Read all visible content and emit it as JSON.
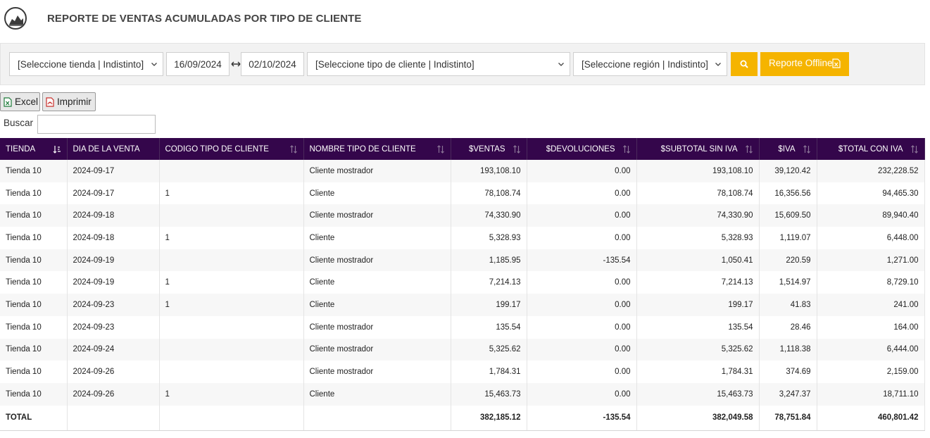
{
  "header": {
    "title": "REPORTE DE VENTAS ACUMULADAS POR TIPO DE CLIENTE",
    "logo_icon": "area-chart-icon"
  },
  "filters": {
    "store": "[Seleccione tienda | Indistinto]",
    "date_from": "16/09/2024",
    "date_to": "02/10/2024",
    "client_type": "[Seleccione tipo de cliente | Indistinto]",
    "region": "[Seleccione región | Indistinto]",
    "offline_label": "Reporte Offline"
  },
  "colors": {
    "accent": "#f5b400",
    "table_header": "#34064b"
  },
  "toolbar": {
    "excel_label": "Excel",
    "print_label": "Imprimir",
    "search_label": "Buscar",
    "search_value": ""
  },
  "table": {
    "columns": [
      "TIENDA",
      "DIA DE LA VENTA",
      "CODIGO TIPO DE CLIENTE",
      "NOMBRE TIPO DE CLIENTE",
      "$VENTAS",
      "$DEVOLUCIONES",
      "$SUBTOTAL SIN IVA",
      "$IVA",
      "$TOTAL CON IVA"
    ],
    "rows": [
      [
        "Tienda 10",
        "2024-09-17",
        "",
        "Cliente mostrador",
        "193,108.10",
        "0.00",
        "193,108.10",
        "39,120.42",
        "232,228.52"
      ],
      [
        "Tienda 10",
        "2024-09-17",
        "1",
        "Cliente",
        "78,108.74",
        "0.00",
        "78,108.74",
        "16,356.56",
        "94,465.30"
      ],
      [
        "Tienda 10",
        "2024-09-18",
        "",
        "Cliente mostrador",
        "74,330.90",
        "0.00",
        "74,330.90",
        "15,609.50",
        "89,940.40"
      ],
      [
        "Tienda 10",
        "2024-09-18",
        "1",
        "Cliente",
        "5,328.93",
        "0.00",
        "5,328.93",
        "1,119.07",
        "6,448.00"
      ],
      [
        "Tienda 10",
        "2024-09-19",
        "",
        "Cliente mostrador",
        "1,185.95",
        "-135.54",
        "1,050.41",
        "220.59",
        "1,271.00"
      ],
      [
        "Tienda 10",
        "2024-09-19",
        "1",
        "Cliente",
        "7,214.13",
        "0.00",
        "7,214.13",
        "1,514.97",
        "8,729.10"
      ],
      [
        "Tienda 10",
        "2024-09-23",
        "1",
        "Cliente",
        "199.17",
        "0.00",
        "199.17",
        "41.83",
        "241.00"
      ],
      [
        "Tienda 10",
        "2024-09-23",
        "",
        "Cliente mostrador",
        "135.54",
        "0.00",
        "135.54",
        "28.46",
        "164.00"
      ],
      [
        "Tienda 10",
        "2024-09-24",
        "",
        "Cliente mostrador",
        "5,325.62",
        "0.00",
        "5,325.62",
        "1,118.38",
        "6,444.00"
      ],
      [
        "Tienda 10",
        "2024-09-26",
        "",
        "Cliente mostrador",
        "1,784.31",
        "0.00",
        "1,784.31",
        "374.69",
        "2,159.00"
      ],
      [
        "Tienda 10",
        "2024-09-26",
        "1",
        "Cliente",
        "15,463.73",
        "0.00",
        "15,463.73",
        "3,247.37",
        "18,711.10"
      ]
    ],
    "total": [
      "TOTAL",
      "",
      "",
      "",
      "382,185.12",
      "-135.54",
      "382,049.58",
      "78,751.84",
      "460,801.42"
    ]
  }
}
